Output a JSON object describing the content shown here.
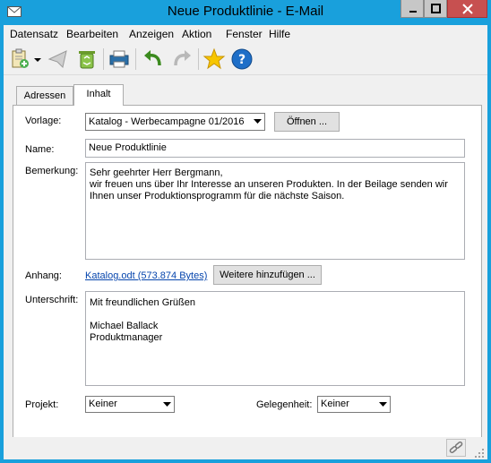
{
  "window": {
    "title": "Neue Produktlinie - E-Mail",
    "accent": "#19a0dc",
    "close_color": "#c75050"
  },
  "menu": {
    "items": [
      "Datensatz",
      "Bearbeiten",
      "Anzeigen",
      "Aktion",
      "Fenster",
      "Hilfe"
    ]
  },
  "toolbar": {
    "icons": [
      "new-document-icon",
      "dropdown-arrow-icon",
      "send-icon",
      "recycle-bin-icon",
      "print-icon",
      "undo-icon",
      "redo-icon",
      "favorite-star-icon",
      "help-icon"
    ]
  },
  "tabs": [
    {
      "label": "Adressen",
      "active": false
    },
    {
      "label": "Inhalt",
      "active": true
    }
  ],
  "form": {
    "vorlage_label": "Vorlage:",
    "vorlage_value": "Katalog - Werbecampagne 01/2016",
    "oeffnen_button": "Öffnen ...",
    "name_label": "Name:",
    "name_value": "Neue Produktlinie",
    "bemerkung_label": "Bemerkung:",
    "bemerkung_lines": [
      "Sehr geehrter Herr Bergmann,",
      "wir freuen uns über Ihr Interesse an unseren Produkten. In der Beilage senden wir",
      "Ihnen unser Produktionsprogramm für die nächste Saison."
    ],
    "anhang_label": "Anhang:",
    "anhang_link": "Katalog.odt (573.874 Bytes)",
    "weitere_button": "Weitere hinzufügen ...",
    "unterschrift_label": "Unterschrift:",
    "unterschrift_lines": [
      "Mit freundlichen Grüßen",
      "",
      "Michael Ballack",
      "Produktmanager"
    ],
    "projekt_label": "Projekt:",
    "projekt_value": "Keiner",
    "gelegenheit_label": "Gelegenheit:",
    "gelegenheit_value": "Keiner"
  }
}
